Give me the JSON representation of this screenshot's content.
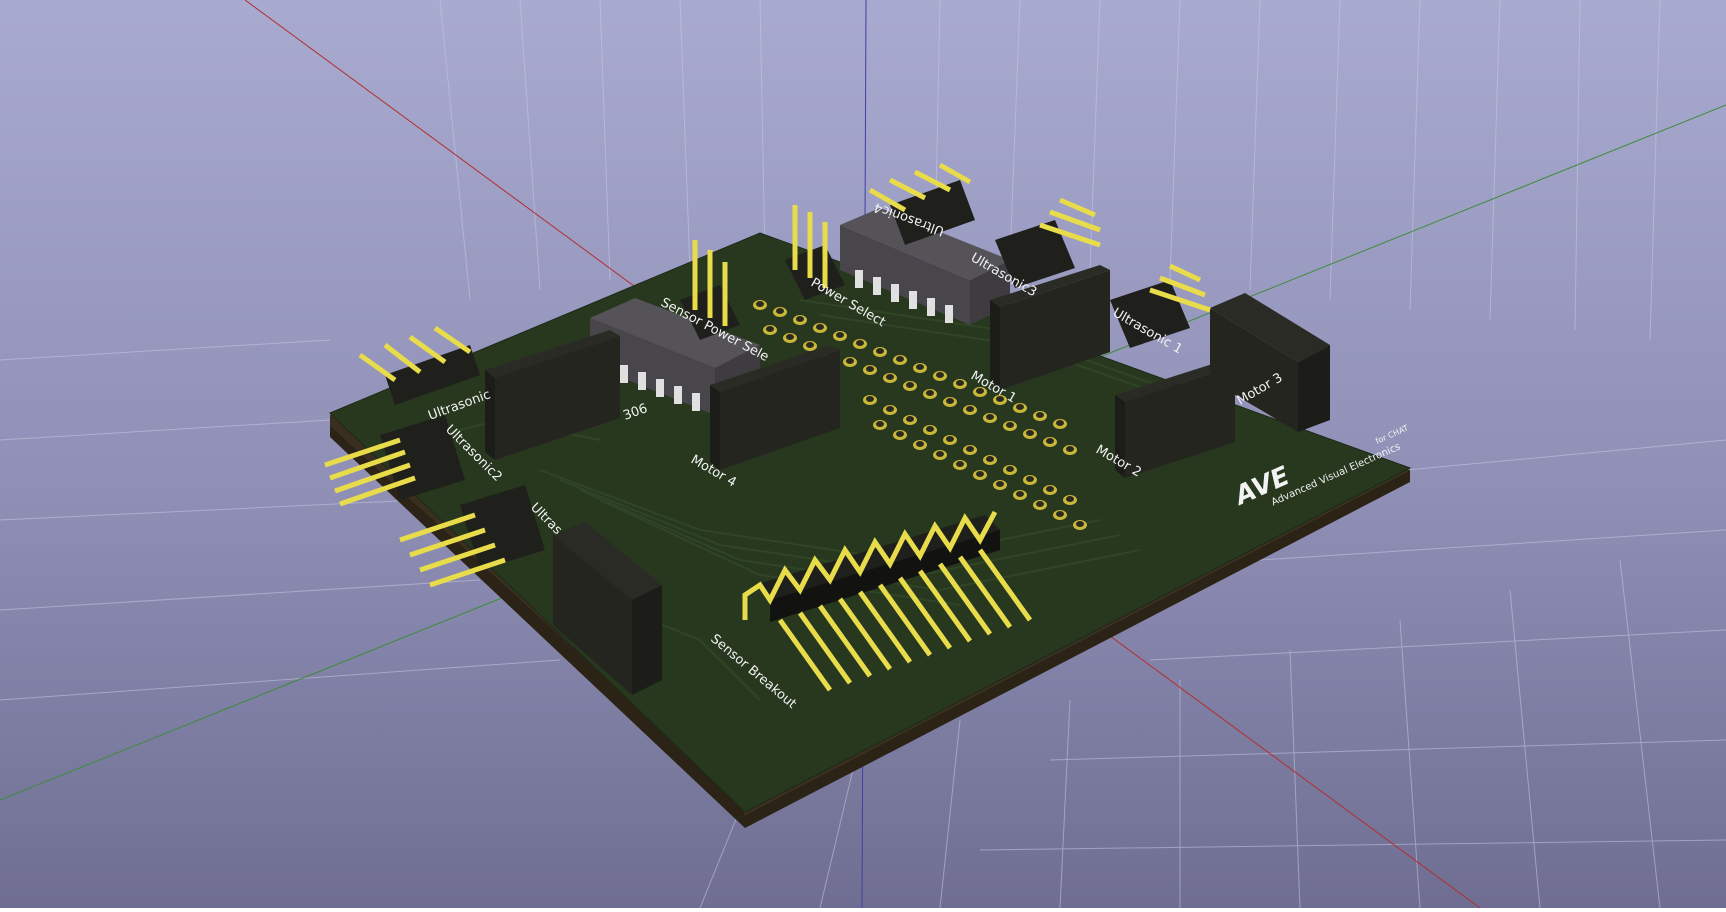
{
  "viewer": {
    "background_top": "#a8a9cf",
    "background_bottom": "#6f6e92"
  },
  "board": {
    "color": "#27381f",
    "edge_color": "#3a2f1e",
    "silk_color": "#f2f2f2",
    "labels": {
      "sensor_breakout": "Sensor Breakout",
      "motor_1": "Motor 1",
      "motor_2": "Motor 2",
      "motor_3": "Motor 3",
      "motor_4": "Motor 4",
      "ultrasonic_1": "Ultrasonic 1",
      "ultrasonic_2": "Ultrasonic2",
      "ultrasonic_3": "Ultrasonic3",
      "ultrasonic_4": "Ultrasonic4",
      "ultrasonic_5": "Ultrasonic",
      "ultrasonic_6": "Ultras",
      "sensor_power_select": "Sensor Power Sele",
      "power_select": "Power Select",
      "ic_label": "306"
    },
    "logo": {
      "mark": "AVE",
      "name": "Advanced Visual Electronics",
      "sub": "for CHAT"
    }
  }
}
